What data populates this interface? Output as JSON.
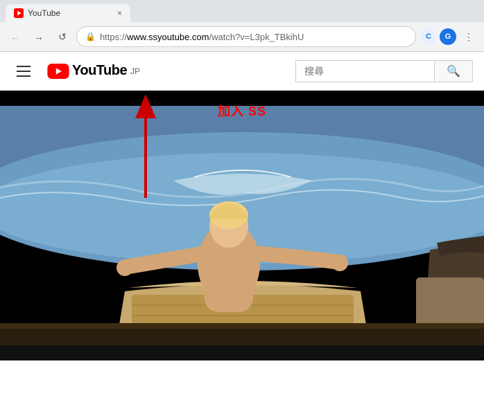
{
  "browser": {
    "tab_title": "YouTube",
    "url_full": "https://www.ssyoutube.com/watch?v=L3pk_TBkihU",
    "url_scheme": "https://",
    "url_domain": "www.ssyoutube.com",
    "url_path": "/watch?v=L3pk_TBkihU",
    "back_label": "←",
    "forward_label": "→",
    "refresh_label": "↺",
    "extension_icon_c": "C",
    "extension_icon_g": "G",
    "extension_icon_menu": "⋮"
  },
  "youtube": {
    "logo_text": "YouTube",
    "logo_suffix": "JP",
    "search_placeholder": "搜尋",
    "search_value": "搜尋"
  },
  "video": {
    "overlay_text": "加入 SS"
  },
  "annotation": {
    "arrow_text": "↑"
  }
}
